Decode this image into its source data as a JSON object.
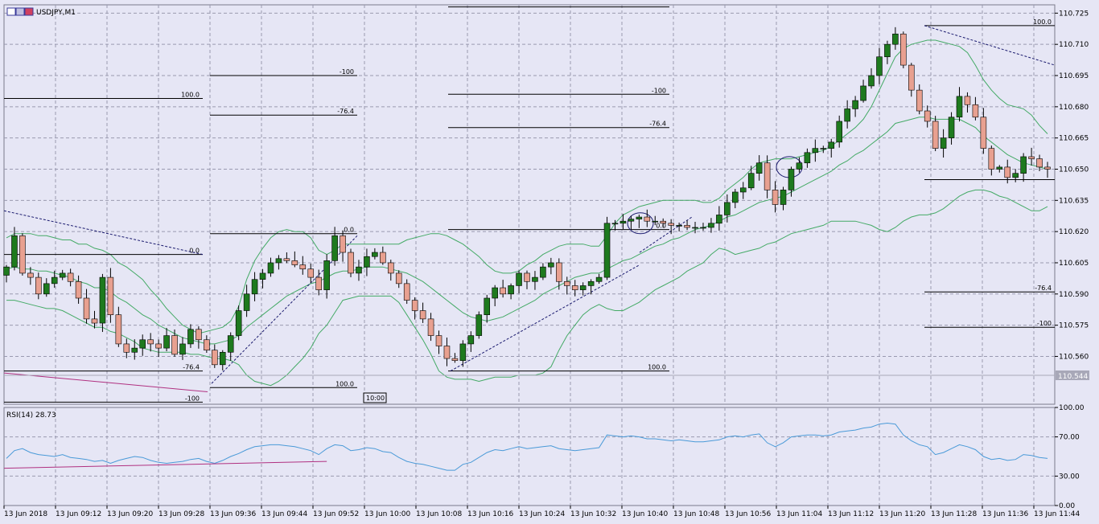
{
  "window": {
    "symbol_label": "USDJPY,M1",
    "title_icon": "chart-window-icon"
  },
  "colors": {
    "background": "#e6e6f5",
    "grid": "#9a9ab0",
    "bull": "#1e7a1e",
    "bear": "#e8a090",
    "bollinger": "#44aa66",
    "rsi": "#4a9ad8",
    "fib": "#000000",
    "trend": "#1a1a6e",
    "pink_line": "#b03080",
    "price_box": "#a8a8b8"
  },
  "chart_data": [
    {
      "type": "candlestick",
      "title": "USDJPY,M1",
      "ylim": [
        110.537,
        110.729
      ],
      "y_ticks": [
        "110.725",
        "110.710",
        "110.695",
        "110.680",
        "110.665",
        "110.650",
        "110.635",
        "110.620",
        "110.605",
        "110.590",
        "110.575",
        "110.560",
        "110.544"
      ],
      "x_ticks": [
        "13 Jun 2018",
        "13 Jun 09:12",
        "13 Jun 09:20",
        "13 Jun 09:28",
        "13 Jun 09:36",
        "13 Jun 09:44",
        "13 Jun 09:52",
        "13 Jun 10:00",
        "13 Jun 10:08",
        "13 Jun 10:16",
        "13 Jun 10:24",
        "13 Jun 10:32",
        "13 Jun 10:40",
        "13 Jun 10:48",
        "13 Jun 10:56",
        "13 Jun 11:04",
        "13 Jun 11:12",
        "13 Jun 11:20",
        "13 Jun 11:28",
        "13 Jun 11:36",
        "13 Jun 11:44"
      ],
      "current_price": "110.544",
      "time_marker": "10:00",
      "closes": [
        110.603,
        110.618,
        110.6,
        110.598,
        110.59,
        110.595,
        110.598,
        110.6,
        110.596,
        110.588,
        110.578,
        110.576,
        110.598,
        110.58,
        110.566,
        110.562,
        110.564,
        110.568,
        110.566,
        110.564,
        110.57,
        110.561,
        110.566,
        110.573,
        110.568,
        110.563,
        110.556,
        110.562,
        110.57,
        110.582,
        110.59,
        110.597,
        110.6,
        110.605,
        110.607,
        110.606,
        110.604,
        110.602,
        110.598,
        110.592,
        110.606,
        110.618,
        110.61,
        110.6,
        110.603,
        110.608,
        110.61,
        110.605,
        110.6,
        110.595,
        110.587,
        110.582,
        110.578,
        110.57,
        110.565,
        110.559,
        110.558,
        110.566,
        110.57,
        110.58,
        110.588,
        110.593,
        110.59,
        110.594,
        110.6,
        110.596,
        110.598,
        110.603,
        110.605,
        110.596,
        110.594,
        110.592,
        110.594,
        110.596,
        110.598,
        110.624,
        110.624,
        110.625,
        110.626,
        110.627,
        110.625,
        110.625,
        110.624,
        110.623,
        110.623,
        110.622,
        110.622,
        110.622,
        110.624,
        110.628,
        110.634,
        110.639,
        110.641,
        110.648,
        110.653,
        110.64,
        110.633,
        110.64,
        110.65,
        110.653,
        110.658,
        110.66,
        110.66,
        110.663,
        110.673,
        110.679,
        110.683,
        110.69,
        110.695,
        110.704,
        110.71,
        110.715,
        110.7,
        110.688,
        110.678,
        110.673,
        110.66,
        110.665,
        110.675,
        110.685,
        110.681,
        110.675,
        110.66,
        110.65,
        110.651,
        110.646,
        110.648,
        110.656,
        110.655,
        110.651,
        110.65
      ],
      "series": [
        {
          "name": "RSI(14)",
          "readout": "28.73"
        }
      ],
      "rsi_ylim": [
        0,
        100
      ],
      "rsi_ticks": [
        "100.00",
        "70.00",
        "30.00",
        "0.00"
      ],
      "rsi": [
        48,
        56,
        58,
        54,
        52,
        51,
        50,
        52,
        49,
        48,
        47,
        45,
        46,
        43,
        46,
        48,
        50,
        49,
        46,
        44,
        43,
        44,
        45,
        47,
        48,
        45,
        43,
        46,
        50,
        53,
        57,
        60,
        61,
        62,
        62,
        61,
        60,
        58,
        56,
        52,
        58,
        62,
        61,
        56,
        57,
        59,
        58,
        55,
        54,
        49,
        45,
        43,
        42,
        40,
        38,
        36,
        36,
        42,
        44,
        49,
        54,
        57,
        56,
        58,
        60,
        58,
        59,
        60,
        61,
        58,
        57,
        56,
        57,
        58,
        59,
        72,
        71,
        70,
        71,
        70,
        68,
        68,
        67,
        66,
        67,
        66,
        65,
        65,
        66,
        67,
        70,
        71,
        70,
        72,
        73,
        64,
        60,
        64,
        70,
        71,
        72,
        72,
        71,
        72,
        75,
        76,
        77,
        79,
        80,
        83,
        84,
        83,
        72,
        66,
        62,
        60,
        52,
        54,
        58,
        62,
        60,
        57,
        50,
        47,
        48,
        46,
        47,
        52,
        51,
        49,
        48
      ],
      "bollinger": {
        "upper": [
          110.617,
          110.619,
          110.619,
          110.619,
          110.618,
          110.618,
          110.617,
          110.616,
          110.616,
          110.614,
          110.614,
          110.612,
          110.611,
          110.609,
          110.605,
          110.603,
          110.6,
          110.597,
          110.592,
          110.588,
          110.583,
          110.579,
          110.575,
          110.573,
          110.571,
          110.572,
          110.573,
          110.574,
          110.577,
          110.584,
          110.597,
          110.606,
          110.612,
          110.617,
          110.62,
          110.621,
          110.62,
          110.62,
          110.617,
          110.611,
          110.609,
          110.611,
          110.614,
          110.614,
          110.614,
          110.614,
          110.614,
          110.614,
          110.614,
          110.614,
          110.616,
          110.617,
          110.618,
          110.619,
          110.619,
          110.618,
          110.616,
          110.614,
          110.611,
          110.608,
          110.604,
          110.601,
          110.6,
          110.6,
          110.601,
          110.604,
          110.606,
          110.609,
          110.611,
          110.613,
          110.614,
          110.614,
          110.614,
          110.613,
          110.613,
          110.618,
          110.624,
          110.628,
          110.63,
          110.632,
          110.633,
          110.634,
          110.635,
          110.635,
          110.635,
          110.635,
          110.635,
          110.634,
          110.634,
          110.636,
          110.64,
          110.643,
          110.646,
          110.65,
          110.653,
          110.654,
          110.655,
          110.655,
          110.655,
          110.656,
          110.657,
          110.658,
          110.659,
          110.661,
          110.664,
          110.667,
          110.67,
          110.674,
          110.68,
          110.688,
          110.696,
          110.704,
          110.708,
          110.71,
          110.711,
          110.712,
          110.712,
          110.711,
          110.71,
          110.709,
          110.706,
          110.7,
          110.693,
          110.688,
          110.684,
          110.681,
          110.68,
          110.679,
          110.676,
          110.671,
          110.667
        ],
        "middle": [
          110.602,
          110.603,
          110.602,
          110.602,
          110.601,
          110.601,
          110.6,
          110.599,
          110.598,
          110.596,
          110.595,
          110.593,
          110.593,
          110.591,
          110.588,
          110.586,
          110.583,
          110.58,
          110.578,
          110.575,
          110.573,
          110.571,
          110.569,
          110.568,
          110.567,
          110.566,
          110.566,
          110.567,
          110.568,
          110.57,
          110.574,
          110.577,
          110.58,
          110.583,
          110.586,
          110.589,
          110.591,
          110.593,
          110.595,
          110.596,
          110.598,
          110.6,
          110.601,
          110.601,
          110.602,
          110.603,
          110.603,
          110.603,
          110.602,
          110.601,
          110.6,
          110.598,
          110.596,
          110.593,
          110.59,
          110.587,
          110.584,
          110.581,
          110.579,
          110.578,
          110.577,
          110.578,
          110.579,
          110.581,
          110.583,
          110.585,
          110.587,
          110.59,
          110.592,
          110.594,
          110.596,
          110.598,
          110.599,
          110.6,
          110.6,
          110.602,
          110.604,
          110.606,
          110.607,
          110.609,
          110.611,
          110.613,
          110.614,
          110.616,
          110.617,
          110.619,
          110.621,
          110.622,
          110.623,
          110.625,
          110.627,
          110.628,
          110.63,
          110.632,
          110.634,
          110.635,
          110.636,
          110.637,
          110.639,
          110.641,
          110.643,
          110.645,
          110.647,
          110.649,
          110.652,
          110.654,
          110.657,
          110.659,
          110.662,
          110.665,
          110.668,
          110.672,
          110.673,
          110.674,
          110.675,
          110.675,
          110.674,
          110.674,
          110.674,
          110.674,
          110.672,
          110.67,
          110.666,
          110.663,
          110.66,
          110.657,
          110.655,
          110.653,
          110.652,
          110.651,
          110.65
        ],
        "lower": [
          110.587,
          110.587,
          110.586,
          110.585,
          110.584,
          110.583,
          110.583,
          110.582,
          110.58,
          110.578,
          110.576,
          110.574,
          110.574,
          110.572,
          110.571,
          110.569,
          110.567,
          110.564,
          110.563,
          110.562,
          110.562,
          110.562,
          110.562,
          110.561,
          110.561,
          110.56,
          110.559,
          110.559,
          110.558,
          110.556,
          110.551,
          110.548,
          110.547,
          110.546,
          110.548,
          110.551,
          110.555,
          110.559,
          110.564,
          110.571,
          110.575,
          110.581,
          110.587,
          110.588,
          110.589,
          110.589,
          110.589,
          110.589,
          110.589,
          110.586,
          110.58,
          110.574,
          110.568,
          110.561,
          110.553,
          110.55,
          110.549,
          110.549,
          110.549,
          110.548,
          110.549,
          110.55,
          110.55,
          110.55,
          110.551,
          110.551,
          110.551,
          110.552,
          110.555,
          110.563,
          110.57,
          110.575,
          110.58,
          110.583,
          110.585,
          110.583,
          110.582,
          110.582,
          110.584,
          110.586,
          110.589,
          110.592,
          110.594,
          110.596,
          110.598,
          110.601,
          110.603,
          110.605,
          110.609,
          110.612,
          110.611,
          110.609,
          110.61,
          110.611,
          110.612,
          110.614,
          110.615,
          110.617,
          110.619,
          110.62,
          110.621,
          110.622,
          110.623,
          110.625,
          110.625,
          110.625,
          110.625,
          110.624,
          110.623,
          110.621,
          110.62,
          110.622,
          110.625,
          110.627,
          110.628,
          110.628,
          110.629,
          110.631,
          110.634,
          110.637,
          110.639,
          110.64,
          110.64,
          110.639,
          110.637,
          110.636,
          110.634,
          110.632,
          110.63,
          110.63,
          110.632
        ]
      },
      "fib_labels": {
        "set1": [
          "100.0",
          "0.0",
          "-76.4",
          "-100"
        ],
        "set2": [
          "-100",
          "-76.4",
          "0.0",
          "100.0"
        ],
        "set3": [
          "-100",
          "-76.4",
          "0.0",
          "100.0"
        ],
        "set4": [
          "100.0",
          "-76.4",
          "-100"
        ]
      }
    }
  ]
}
